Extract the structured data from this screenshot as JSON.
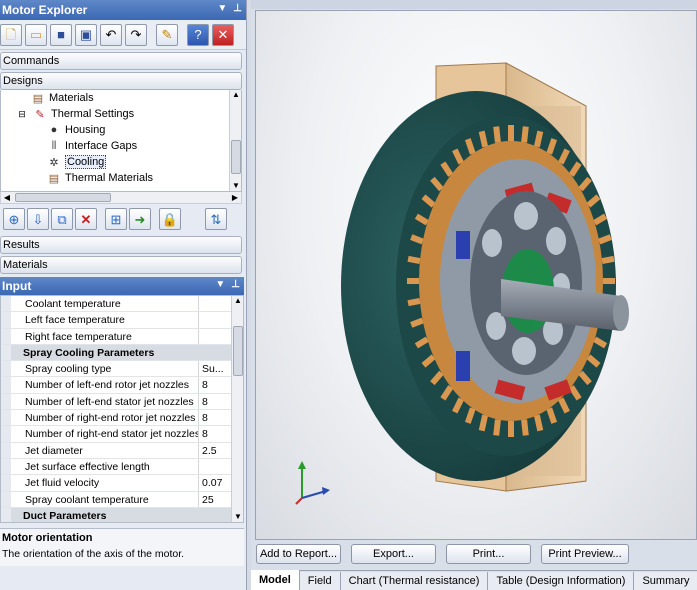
{
  "explorer": {
    "title": "Motor Explorer",
    "toolbar_icons": [
      "new-icon",
      "open-icon",
      "save-icon",
      "save-as-icon",
      "undo-icon",
      "redo-icon",
      "properties-icon",
      "help-icon",
      "close-icon"
    ],
    "sections": {
      "commands": "Commands",
      "designs": "Designs",
      "results": "Results",
      "materials": "Materials"
    },
    "tree": [
      {
        "label": "Materials",
        "icon": "materials-icon"
      },
      {
        "label": "Thermal Settings",
        "icon": "thermal-settings-icon"
      },
      {
        "label": "Housing",
        "icon": "housing-icon"
      },
      {
        "label": "Interface Gaps",
        "icon": "interface-gaps-icon"
      },
      {
        "label": "Cooling",
        "icon": "cooling-icon",
        "selected": true
      },
      {
        "label": "Thermal Materials",
        "icon": "thermal-materials-icon"
      }
    ]
  },
  "input": {
    "title": "Input",
    "rows": [
      {
        "name": "Coolant temperature",
        "value": ""
      },
      {
        "name": "Left face temperature",
        "value": ""
      },
      {
        "name": "Right face temperature",
        "value": ""
      },
      {
        "name": "Spray Cooling Parameters",
        "category": true
      },
      {
        "name": "Spray cooling type",
        "value": "Su..."
      },
      {
        "name": "Number of left-end rotor jet nozzles",
        "value": "8"
      },
      {
        "name": "Number of left-end stator jet nozzles",
        "value": "8"
      },
      {
        "name": "Number of right-end rotor jet nozzles",
        "value": "8"
      },
      {
        "name": "Number of right-end stator jet nozzles",
        "value": "8"
      },
      {
        "name": "Jet diameter",
        "value": "2.5"
      },
      {
        "name": "Jet surface effective length",
        "value": ""
      },
      {
        "name": "Jet fluid velocity",
        "value": "0.07"
      },
      {
        "name": "Spray coolant temperature",
        "value": "25"
      },
      {
        "name": "Duct Parameters",
        "category": true
      }
    ],
    "description": {
      "title": "Motor orientation",
      "text": "The orientation of the axis of the motor."
    }
  },
  "view": {
    "buttons": {
      "add_to_report": "Add to Report...",
      "export": "Export...",
      "print": "Print...",
      "print_preview": "Print Preview..."
    },
    "tabs": [
      "Model",
      "Field",
      "Chart (Thermal resistance)",
      "Table (Design Information)",
      "Summary"
    ],
    "active_tab": "Model"
  },
  "colors": {
    "title_bar": "#3b68b3",
    "housing": "#1f4a4a",
    "winding": "#d9974f",
    "frame": "#e8c9a0",
    "shaft": "#7d8590",
    "magnet_red": "#c42b2b",
    "magnet_blue": "#2b3fb0"
  }
}
